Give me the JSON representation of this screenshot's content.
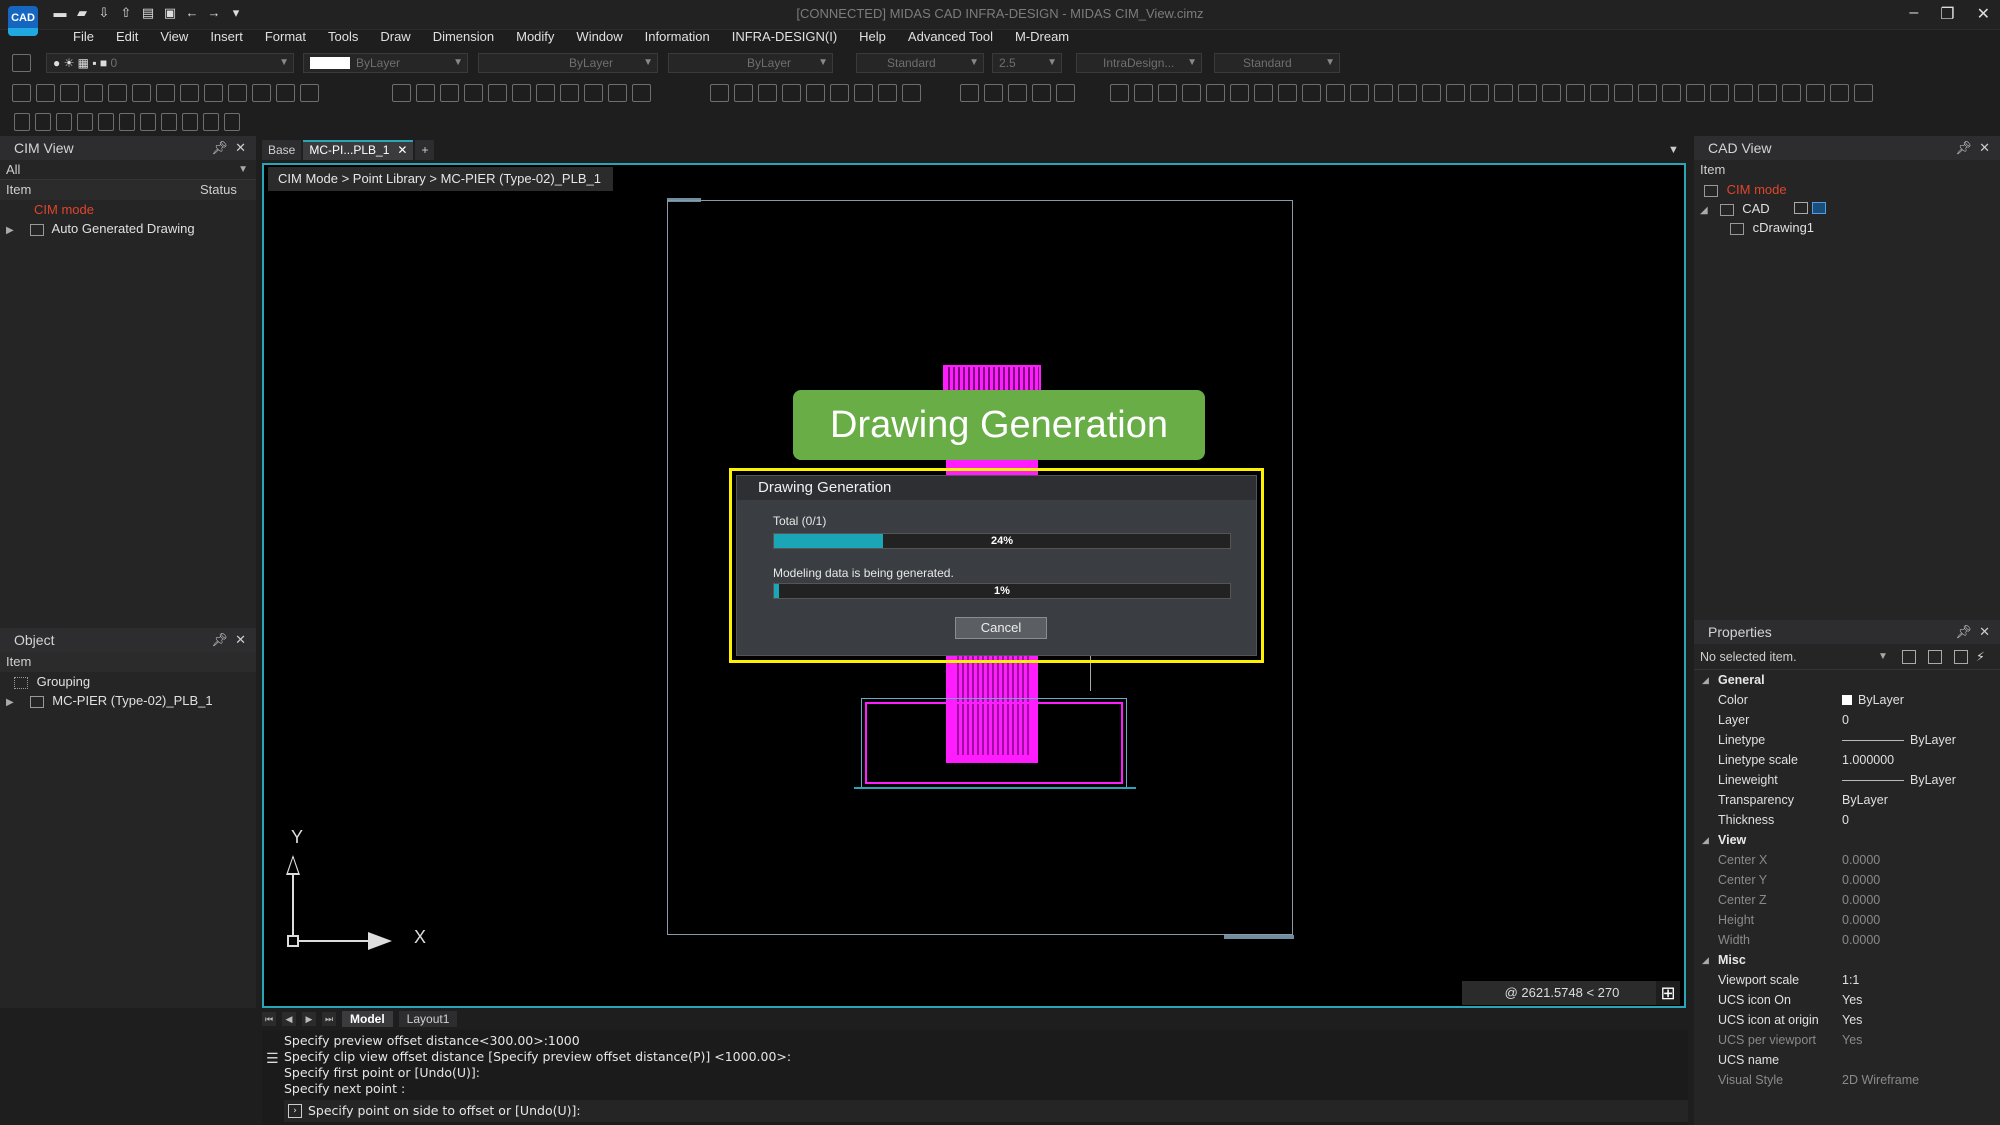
{
  "app": {
    "logo_text": "CAD",
    "window_title": "[CONNECTED] MIDAS CAD INFRA-DESIGN - MIDAS CIM_View.cimz"
  },
  "menu": [
    "File",
    "Edit",
    "View",
    "Insert",
    "Format",
    "Tools",
    "Draw",
    "Dimension",
    "Modify",
    "Window",
    "Information",
    "INFRA-DESIGN(I)",
    "Help",
    "Advanced Tool",
    "M-Dream"
  ],
  "toolbar": {
    "layer_value": "0",
    "color_value": "ByLayer",
    "linetype_value": "ByLayer",
    "lineweight_value": "ByLayer",
    "text_style": "Standard",
    "text_height": "2.5",
    "dim_style": "IntraDesign...",
    "table_style": "Standard"
  },
  "cim_view": {
    "title": "CIM View",
    "filter": "All",
    "col_item": "Item",
    "col_status": "Status",
    "items": [
      {
        "label": "CIM mode"
      },
      {
        "label": "Auto Generated Drawing"
      }
    ]
  },
  "object_panel": {
    "title": "Object",
    "col_item": "Item",
    "items": [
      {
        "label": "Grouping"
      },
      {
        "label": "MC-PIER (Type-02)_PLB_1"
      }
    ]
  },
  "doc_tabs": [
    {
      "label": "Base"
    },
    {
      "label": "MC-PI...PLB_1"
    }
  ],
  "breadcrumb": "CIM Mode > Point Library > MC-PIER (Type-02)_PLB_1",
  "banner": "Drawing Generation",
  "dialog": {
    "title": "Drawing Generation",
    "total_label": "Total (0/1)",
    "total_progress": 24,
    "total_pct_text": "24%",
    "task_label": "Modeling data is being generated.",
    "task_progress": 1,
    "task_pct_text": "1%",
    "cancel_label": "Cancel"
  },
  "ucs": {
    "y_label": "Y",
    "x_label": "X"
  },
  "coords_readout": "@ 2621.5748 < 270",
  "layout_tabs": [
    "Model",
    "Layout1"
  ],
  "command": {
    "lines": [
      "Specify preview offset distance<300.00>:1000",
      "Specify clip view offset distance [Specify preview offset distance(P)] <1000.00>:",
      "Specify first point or [Undo(U)]:",
      "Specify next point :"
    ],
    "prompt": "Specify point on side to offset or [Undo(U)]:"
  },
  "cad_view": {
    "title": "CAD View",
    "col_item": "Item",
    "items": [
      {
        "label": "CIM mode"
      },
      {
        "label": "CAD"
      },
      {
        "label": "cDrawing1"
      }
    ]
  },
  "properties": {
    "title": "Properties",
    "selection": "No selected item.",
    "general_label": "General",
    "general": [
      {
        "k": "Color",
        "v": "ByLayer"
      },
      {
        "k": "Layer",
        "v": "0"
      },
      {
        "k": "Linetype",
        "v": "ByLayer"
      },
      {
        "k": "Linetype scale",
        "v": "1.000000"
      },
      {
        "k": "Lineweight",
        "v": "ByLayer"
      },
      {
        "k": "Transparency",
        "v": "ByLayer"
      },
      {
        "k": "Thickness",
        "v": "0"
      }
    ],
    "view_label": "View",
    "view": [
      {
        "k": "Center X",
        "v": "0.0000"
      },
      {
        "k": "Center Y",
        "v": "0.0000"
      },
      {
        "k": "Center Z",
        "v": "0.0000"
      },
      {
        "k": "Height",
        "v": "0.0000"
      },
      {
        "k": "Width",
        "v": "0.0000"
      }
    ],
    "misc_label": "Misc",
    "misc": [
      {
        "k": "Viewport scale",
        "v": "1:1"
      },
      {
        "k": "UCS icon On",
        "v": "Yes"
      },
      {
        "k": "UCS icon at origin",
        "v": "Yes"
      },
      {
        "k": "UCS per viewport",
        "v": "Yes"
      },
      {
        "k": "UCS name",
        "v": ""
      },
      {
        "k": "Visual Style",
        "v": "2D Wireframe"
      }
    ]
  },
  "colors": {
    "accent": "#2aa5b8",
    "banner": "#68ad45",
    "highlight": "#fff200",
    "pier": "#ff1cff",
    "cim_mode_red": "#e0452b"
  }
}
